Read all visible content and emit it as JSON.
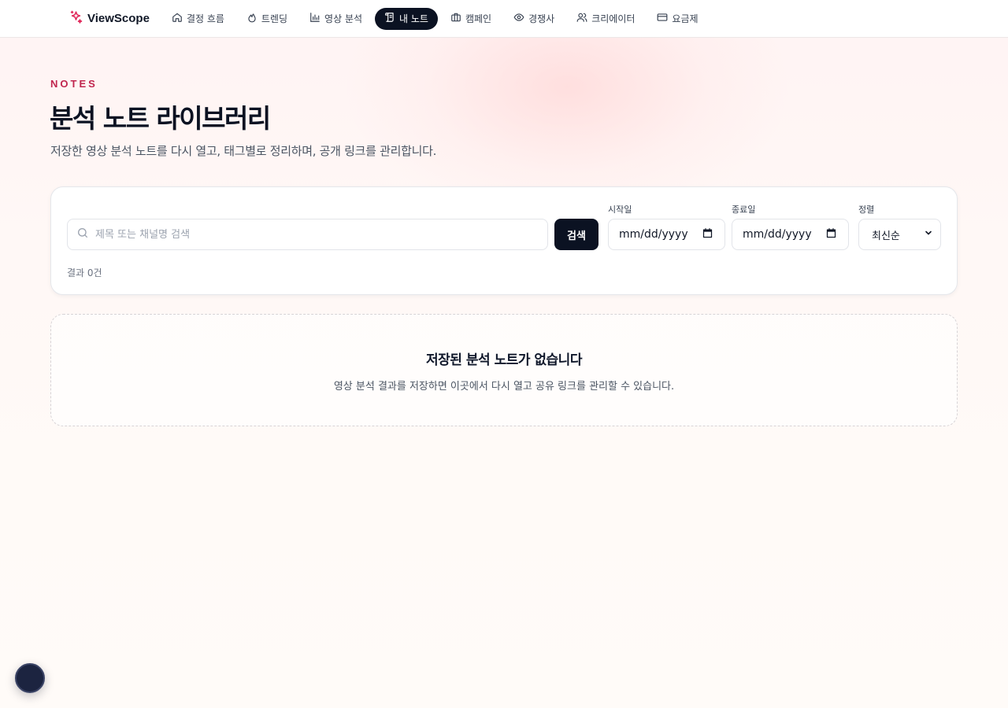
{
  "nav": {
    "brand": "ViewScope",
    "items": [
      {
        "label": "결정 흐름",
        "icon": "home-icon"
      },
      {
        "label": "트렌딩",
        "icon": "flame-icon"
      },
      {
        "label": "영상 분석",
        "icon": "bar-chart-icon"
      },
      {
        "label": "내 노트",
        "icon": "notes-icon",
        "active": true
      },
      {
        "label": "캠페인",
        "icon": "briefcase-icon"
      },
      {
        "label": "경쟁사",
        "icon": "eye-icon"
      },
      {
        "label": "크리에이터",
        "icon": "users-icon"
      },
      {
        "label": "요금제",
        "icon": "credit-card-icon"
      }
    ]
  },
  "header": {
    "eyebrow": "NOTES",
    "title": "분석 노트 라이브러리",
    "subtitle": "저장한 영상 분석 노트를 다시 열고, 태그별로 정리하며, 공개 링크를 관리합니다."
  },
  "filters": {
    "search_placeholder": "제목 또는 채널명 검색",
    "search_button": "검색",
    "start_label": "시작일",
    "start_value": "mm/dd/yyyy",
    "end_label": "종료일",
    "end_value": "mm/dd/yyyy",
    "sort_label": "정렬",
    "sort_value": "최신순",
    "result_count": "결과 0건"
  },
  "empty": {
    "title": "저장된 분석 노트가 없습니다",
    "description": "영상 분석 결과를 저장하면 이곳에서 다시 열고 공유 링크를 관리할 수 있습니다."
  },
  "colors": {
    "accent": "#c0264e",
    "dark": "#0b1222"
  }
}
